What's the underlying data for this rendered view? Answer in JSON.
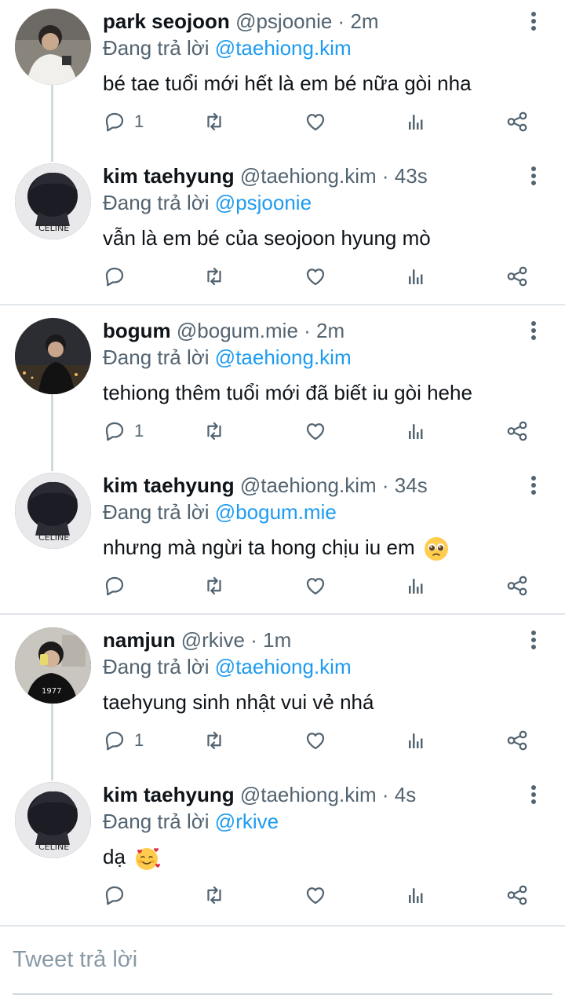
{
  "reply_prefix": "Đang trả lời",
  "tweets": [
    {
      "name": "park seojoon",
      "handle": "@psjoonie",
      "sep": "·",
      "time": "2m",
      "reply_to": "@taehiong.kim",
      "text": "bé tae tuổi mới hết là em bé nữa gòi nha",
      "reply_count": "1"
    },
    {
      "name": "kim taehyung",
      "handle": "@taehiong.kim",
      "sep": "·",
      "time": "43s",
      "reply_to": "@psjoonie",
      "text": "vẫn là em bé của seojoon hyung mò",
      "reply_count": ""
    },
    {
      "name": "bogum",
      "handle": "@bogum.mie",
      "sep": "·",
      "time": "2m",
      "reply_to": "@taehiong.kim",
      "text": "tehiong thêm tuổi mới đã biết iu gòi hehe",
      "reply_count": "1"
    },
    {
      "name": "kim taehyung",
      "handle": "@taehiong.kim",
      "sep": "·",
      "time": "34s",
      "reply_to": "@bogum.mie",
      "text": "nhưng mà ngừi ta hong chịu iu em",
      "reply_count": ""
    },
    {
      "name": "namjun",
      "handle": "@rkive",
      "sep": "·",
      "time": "1m",
      "reply_to": "@taehiong.kim",
      "text": "taehyung sinh nhật vui vẻ nhá",
      "reply_count": "1"
    },
    {
      "name": "kim taehyung",
      "handle": "@taehiong.kim",
      "sep": "·",
      "time": "4s",
      "reply_to": "@rkive",
      "text": "dạ",
      "reply_count": ""
    }
  ],
  "reply_box": {
    "placeholder": "Tweet trả lời"
  },
  "colors": {
    "link": "#1d9bf0",
    "muted": "#536471",
    "text": "#0f1419",
    "divider": "#e1e6ea"
  },
  "icons": [
    "reply-icon",
    "retweet-icon",
    "like-icon",
    "analytics-icon",
    "share-icon",
    "more-options-icon",
    "pleading-face-emoji",
    "smiling-hearts-emoji"
  ]
}
